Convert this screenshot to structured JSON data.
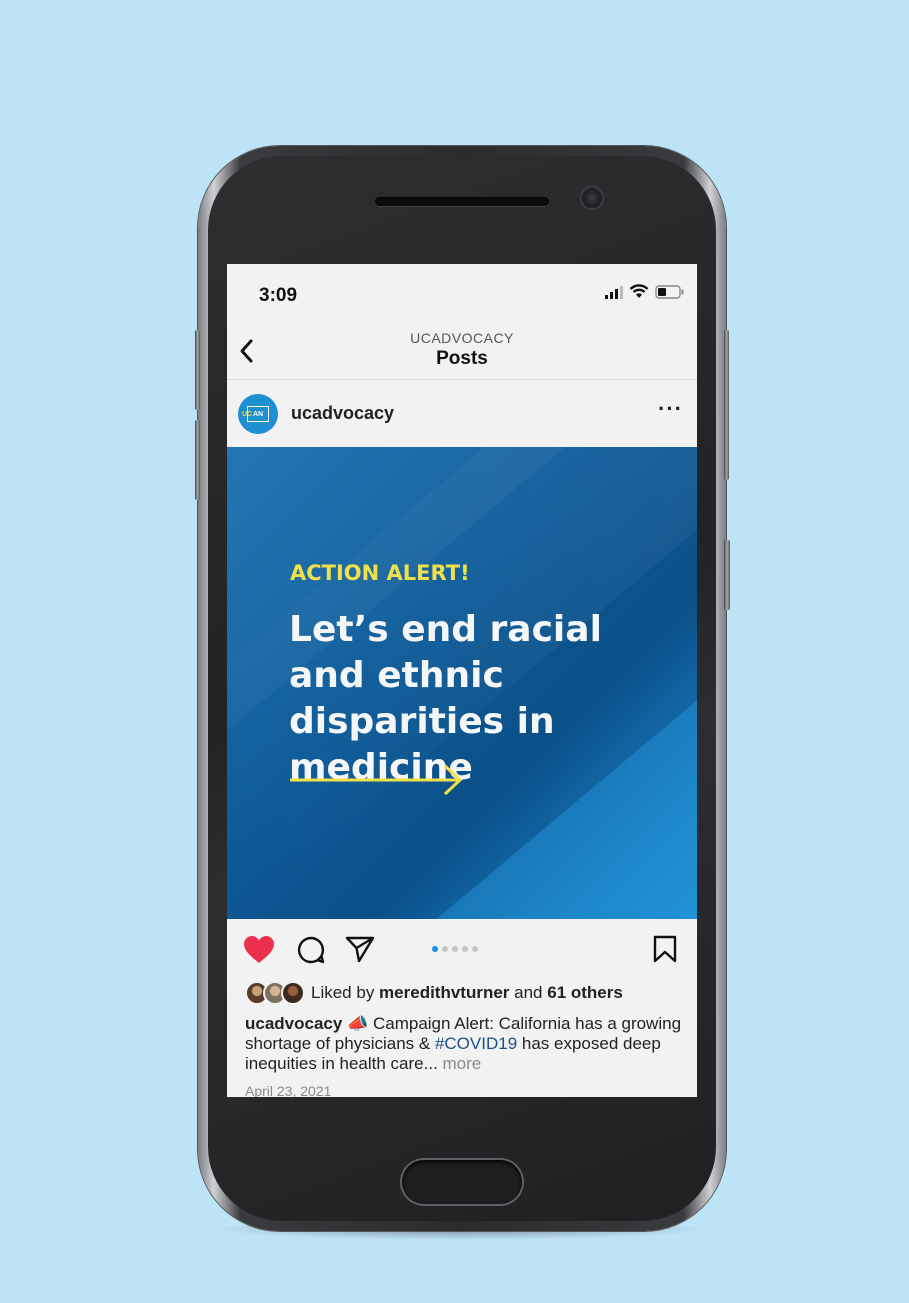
{
  "status_bar": {
    "time": "3:09"
  },
  "nav": {
    "subtitle": "UCADVOCACY",
    "title": "Posts"
  },
  "post": {
    "username": "ucadvocacy",
    "avatar_text": "AN",
    "avatar_prefix": "UC",
    "image": {
      "alert": "ACTION ALERT!",
      "headline": "Let’s end racial and ethnic disparities in medicine"
    },
    "carousel": {
      "total": 5,
      "active_index": 0
    },
    "liked": true,
    "likes": {
      "prefix": "Liked by ",
      "user": "meredithvturner",
      "middle": " and ",
      "others": "61 others"
    },
    "caption": {
      "user": "ucadvocacy",
      "emoji": "📣",
      "text_before": " Campaign Alert: California has a growing shortage of physicians & ",
      "hashtag": "#COVID19",
      "text_after": " has exposed deep inequities in health care... ",
      "more": "more"
    },
    "date": "April 23, 2021"
  },
  "colors": {
    "background": "#bde3f6",
    "heart": "#ed2f4e",
    "alert_yellow": "#f0e04a",
    "image_blue": "#0f5c99",
    "hashtag": "#1e4f8c",
    "active_dot": "#1a8de2"
  }
}
